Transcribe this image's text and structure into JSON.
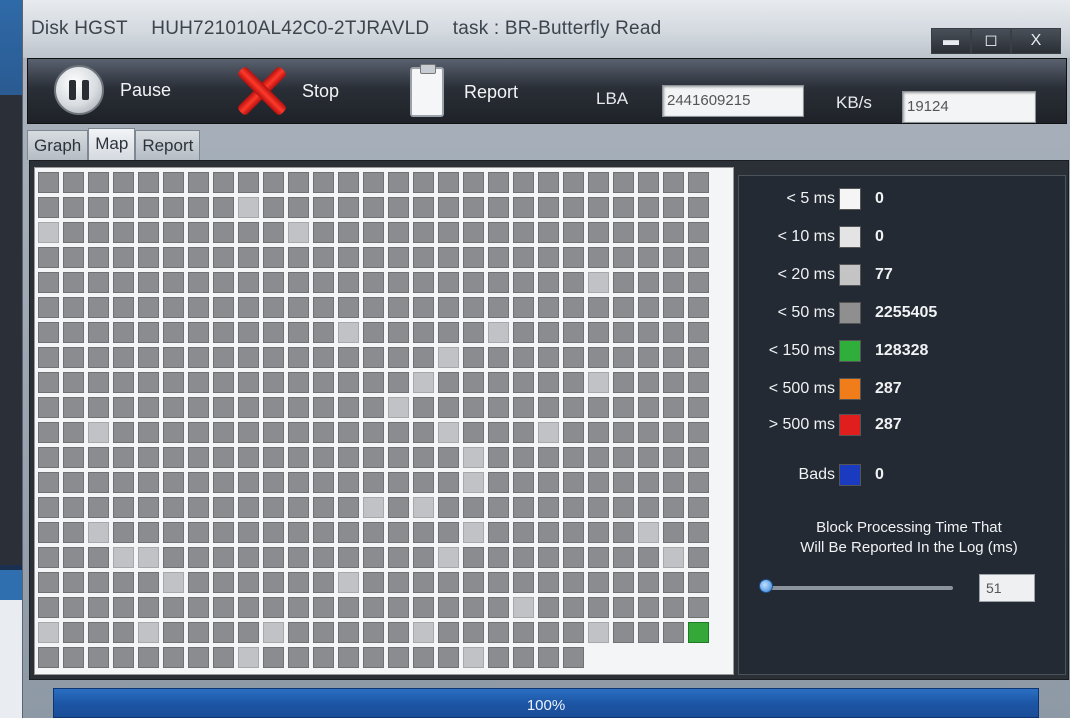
{
  "title": {
    "disk": "Disk HGST",
    "model": "HUH721010AL42C0-2TJRAVLD",
    "task": "task : BR-Butterfly Read"
  },
  "window_controls": {
    "minimize": "▬",
    "maximize": "◻",
    "close": "X"
  },
  "toolbar": {
    "pause_label": "Pause",
    "stop_label": "Stop",
    "report_label": "Report",
    "lba_label": "LBA",
    "lba_value": "2441609215",
    "speed_label": "KB/s",
    "speed_value": "19124"
  },
  "tabs": [
    {
      "label": "Graph",
      "active": false
    },
    {
      "label": "Map",
      "active": true
    },
    {
      "label": "Report",
      "active": false
    }
  ],
  "legend": [
    {
      "label": "< 5 ms",
      "color": "#f5f5f5",
      "count": "0"
    },
    {
      "label": "< 10 ms",
      "color": "#e4e4e4",
      "count": "0"
    },
    {
      "label": "< 20 ms",
      "color": "#c4c4c4",
      "count": "77"
    },
    {
      "label": "< 50 ms",
      "color": "#8f8f8f",
      "count": "2255405"
    },
    {
      "label": "< 150 ms",
      "color": "#2fae3c",
      "count": "128328"
    },
    {
      "label": "< 500 ms",
      "color": "#f07c1a",
      "count": "287"
    },
    {
      "label": "> 500 ms",
      "color": "#e01e1e",
      "count": "287"
    },
    {
      "label": "Bads",
      "color": "#1a3bbf",
      "count": "0"
    }
  ],
  "block_time": {
    "title_line1": "Block Processing Time That",
    "title_line2": "Will Be Reported In the Log (ms)",
    "value": "51"
  },
  "progress": {
    "text": "100%",
    "percent": 100
  },
  "map": {
    "columns": 27,
    "full_rows": 19,
    "last_row_cells": 22
  }
}
